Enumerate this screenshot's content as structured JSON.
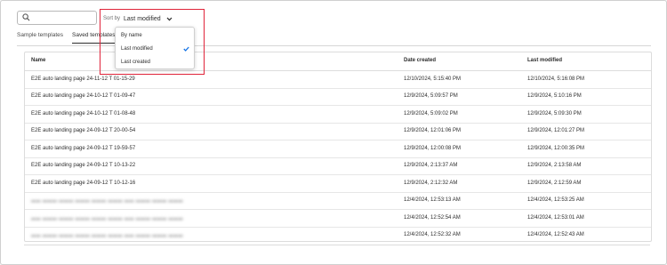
{
  "search": {
    "placeholder": ""
  },
  "sort": {
    "label": "Sort by",
    "value": "Last modified"
  },
  "tabs": [
    {
      "label": "Sample templates",
      "active": false
    },
    {
      "label": "Saved templates",
      "active": true
    }
  ],
  "table": {
    "columns": [
      "Name",
      "Date created",
      "Last modified"
    ],
    "rows": [
      {
        "name": "E2E auto landing page 24-11-12 T 01-15-29",
        "created": "12/10/2024, 5:15:40 PM",
        "modified": "12/10/2024, 5:16:08 PM"
      },
      {
        "name": "E2E auto landing page 24-10-12 T 01-09-47",
        "created": "12/9/2024, 5:09:57 PM",
        "modified": "12/9/2024, 5:10:16 PM"
      },
      {
        "name": "E2E auto landing page 24-10-12 T 01-08-48",
        "created": "12/9/2024, 5:09:02 PM",
        "modified": "12/9/2024, 5:09:30 PM"
      },
      {
        "name": "E2E auto landing page 24-09-12 T 20-00-54",
        "created": "12/9/2024, 12:01:06 PM",
        "modified": "12/9/2024, 12:01:27 PM"
      },
      {
        "name": "E2E auto landing page 24-09-12 T 19-59-57",
        "created": "12/9/2024, 12:00:08 PM",
        "modified": "12/9/2024, 12:00:35 PM"
      },
      {
        "name": "E2E auto landing page 24-09-12 T 10-13-22",
        "created": "12/9/2024, 2:13:37 AM",
        "modified": "12/9/2024, 2:13:58 AM"
      },
      {
        "name": "E2E auto landing page 24-09-12 T 10-12-16",
        "created": "12/9/2024, 2:12:32 AM",
        "modified": "12/9/2024, 2:12:59 AM"
      },
      {
        "name": "",
        "created": "12/4/2024, 12:53:13 AM",
        "modified": "12/4/2024, 12:53:25 AM"
      },
      {
        "name": "",
        "created": "12/4/2024, 12:52:54 AM",
        "modified": "12/4/2024, 12:53:01 AM"
      },
      {
        "name": "",
        "created": "12/4/2024, 12:52:32 AM",
        "modified": "12/4/2024, 12:52:43 AM"
      }
    ]
  },
  "dropdown": {
    "options": [
      {
        "label": "By name",
        "selected": false
      },
      {
        "label": "Last modified",
        "selected": true
      },
      {
        "label": "Last created",
        "selected": false
      }
    ]
  },
  "colors": {
    "accent": "#1473e6",
    "highlight": "#e0243a"
  },
  "icons": {
    "search": "search-icon",
    "sort_chevron": "chevron-down-icon",
    "selected": "checkmark-icon"
  }
}
